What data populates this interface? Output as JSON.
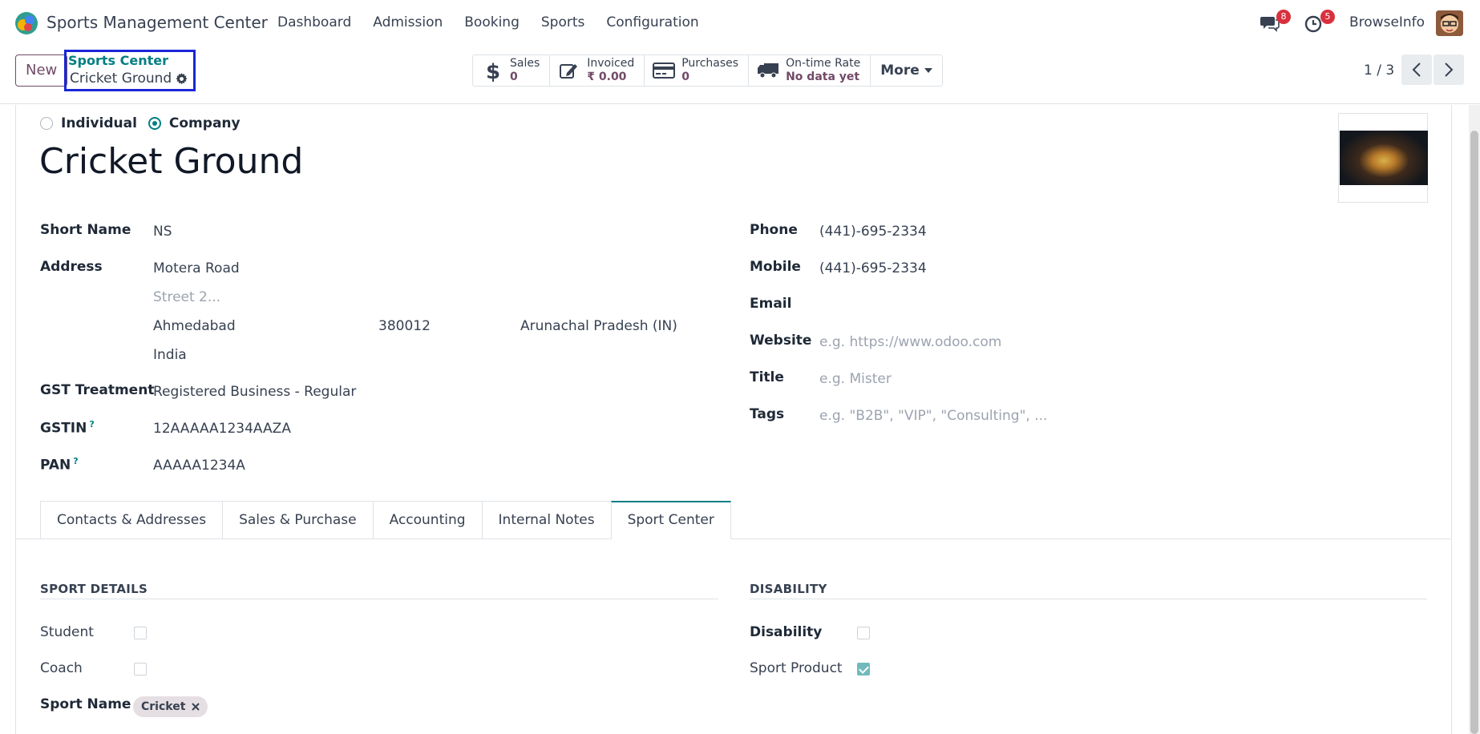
{
  "navbar": {
    "app_title": "Sports Management Center",
    "menu": [
      "Dashboard",
      "Admission",
      "Booking",
      "Sports",
      "Configuration"
    ],
    "messages_count": "8",
    "activities_count": "5",
    "company": "BrowseInfo"
  },
  "control": {
    "new_label": "New",
    "breadcrumb_parent": "Sports Center",
    "breadcrumb_current": "Cricket Ground",
    "stats": [
      {
        "label": "Sales",
        "value": "0",
        "icon": "dollar-icon"
      },
      {
        "label": "Invoiced",
        "value": "₹ 0.00",
        "icon": "edit-icon"
      },
      {
        "label": "Purchases",
        "value": "0",
        "icon": "credit-card-icon"
      },
      {
        "label": "On-time Rate",
        "value": "No data yet",
        "icon": "truck-icon"
      }
    ],
    "more_label": "More",
    "pager": "1 / 3"
  },
  "form": {
    "type_options": [
      "Individual",
      "Company"
    ],
    "selected_type": "Company",
    "name": "Cricket Ground",
    "left_fields": {
      "short_name_label": "Short Name",
      "short_name": "NS",
      "address_label": "Address",
      "street": "Motera Road",
      "street2_placeholder": "Street 2...",
      "city": "Ahmedabad",
      "zip": "380012",
      "state": "Arunachal Pradesh (IN)",
      "country": "India",
      "gst_label": "GST Treatment",
      "gst": "Registered Business - Regular",
      "gstin_label": "GSTIN",
      "gstin": "12AAAAA1234AAZA",
      "pan_label": "PAN",
      "pan": "AAAAA1234A",
      "help_mark": "?"
    },
    "right_fields": {
      "phone_label": "Phone",
      "phone": "(441)-695-2334",
      "mobile_label": "Mobile",
      "mobile": "(441)-695-2334",
      "email_label": "Email",
      "website_label": "Website",
      "website_placeholder": "e.g. https://www.odoo.com",
      "title_label": "Title",
      "title_placeholder": "e.g. Mister",
      "tags_label": "Tags",
      "tags_placeholder": "e.g. \"B2B\", \"VIP\", \"Consulting\", ..."
    },
    "tabs": [
      "Contacts & Addresses",
      "Sales & Purchase",
      "Accounting",
      "Internal Notes",
      "Sport Center"
    ],
    "active_tab": "Sport Center",
    "sport_details": {
      "title": "SPORT DETAILS",
      "student_label": "Student",
      "student": false,
      "coach_label": "Coach",
      "coach": false,
      "sport_name_label": "Sport Name",
      "sport_tag": "Cricket"
    },
    "disability": {
      "title": "DISABILITY",
      "disability_label": "Disability",
      "disability": false,
      "sport_product_label": "Sport Product",
      "sport_product": true
    }
  },
  "colors": {
    "accent": "#017e84",
    "brand": "#714b67",
    "badge": "#d9303d",
    "highlight": "#1a26d6"
  }
}
